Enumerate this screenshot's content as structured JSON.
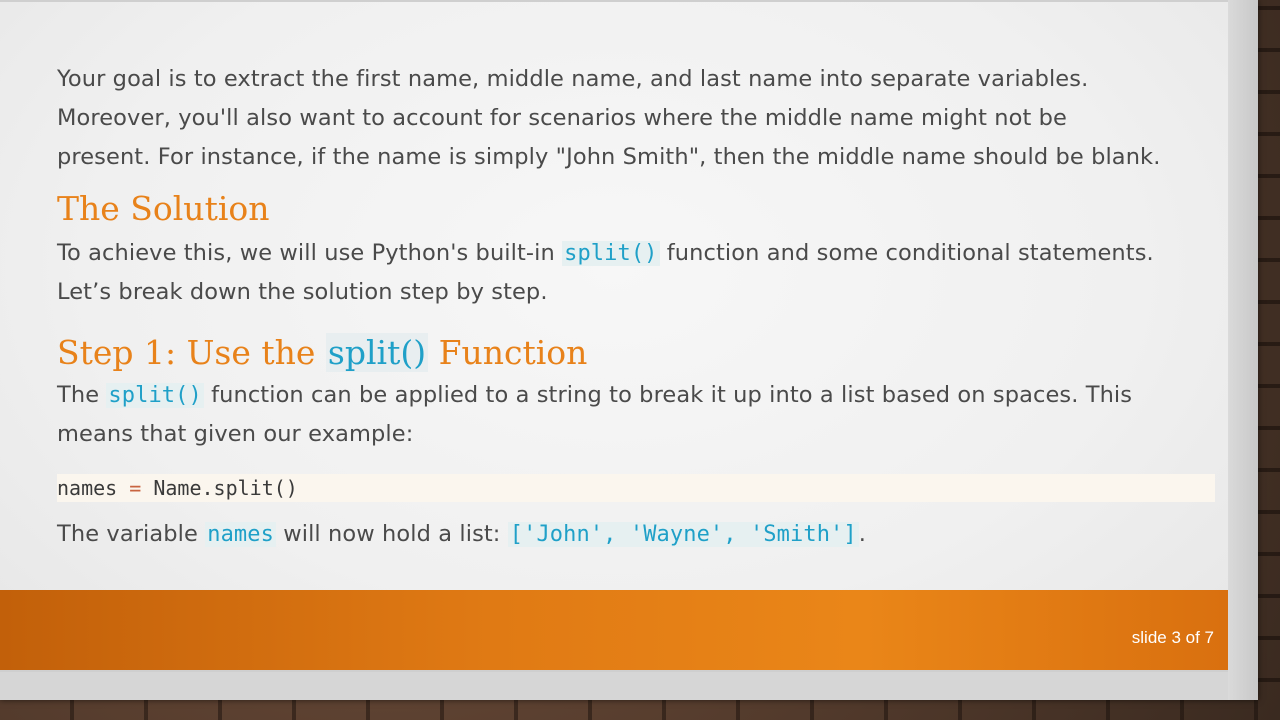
{
  "intro": {
    "line1": "Your goal is to extract the first name, middle name, and last name into separate variables.",
    "line2": "Moreover, you'll also want to account for scenarios where the middle name might not be",
    "line3": "present. For instance, if the name is simply \"John Smith\", then the middle name should be blank."
  },
  "solution": {
    "heading": "The Solution",
    "text_before": "To achieve this, we will use Python's built-in ",
    "code": "split()",
    "text_after": " function and some conditional statements.",
    "line2": "Let’s break down the solution step by step."
  },
  "step1": {
    "heading_prefix": "Step 1: Use the ",
    "heading_code": "split()",
    "heading_suffix": " Function",
    "text_prefix": "The ",
    "code": "split()",
    "text_after": " function can be applied to a string to break it up into a list based on spaces. This",
    "line2": "means that given our example:"
  },
  "codeblock": {
    "lhs": "names",
    "op": " = ",
    "rhs": "Name.split()"
  },
  "variable_line": {
    "prefix": "The variable ",
    "code_var": "names",
    "middle": " will now hold a list: ",
    "code_list": "['John', 'Wayne', 'Smith']",
    "suffix": "."
  },
  "footer": {
    "slide_number": "slide 3 of 7"
  },
  "colors": {
    "heading": "#e8821a",
    "code": "#1fa0c8",
    "footer_bar": "#e07a14"
  }
}
